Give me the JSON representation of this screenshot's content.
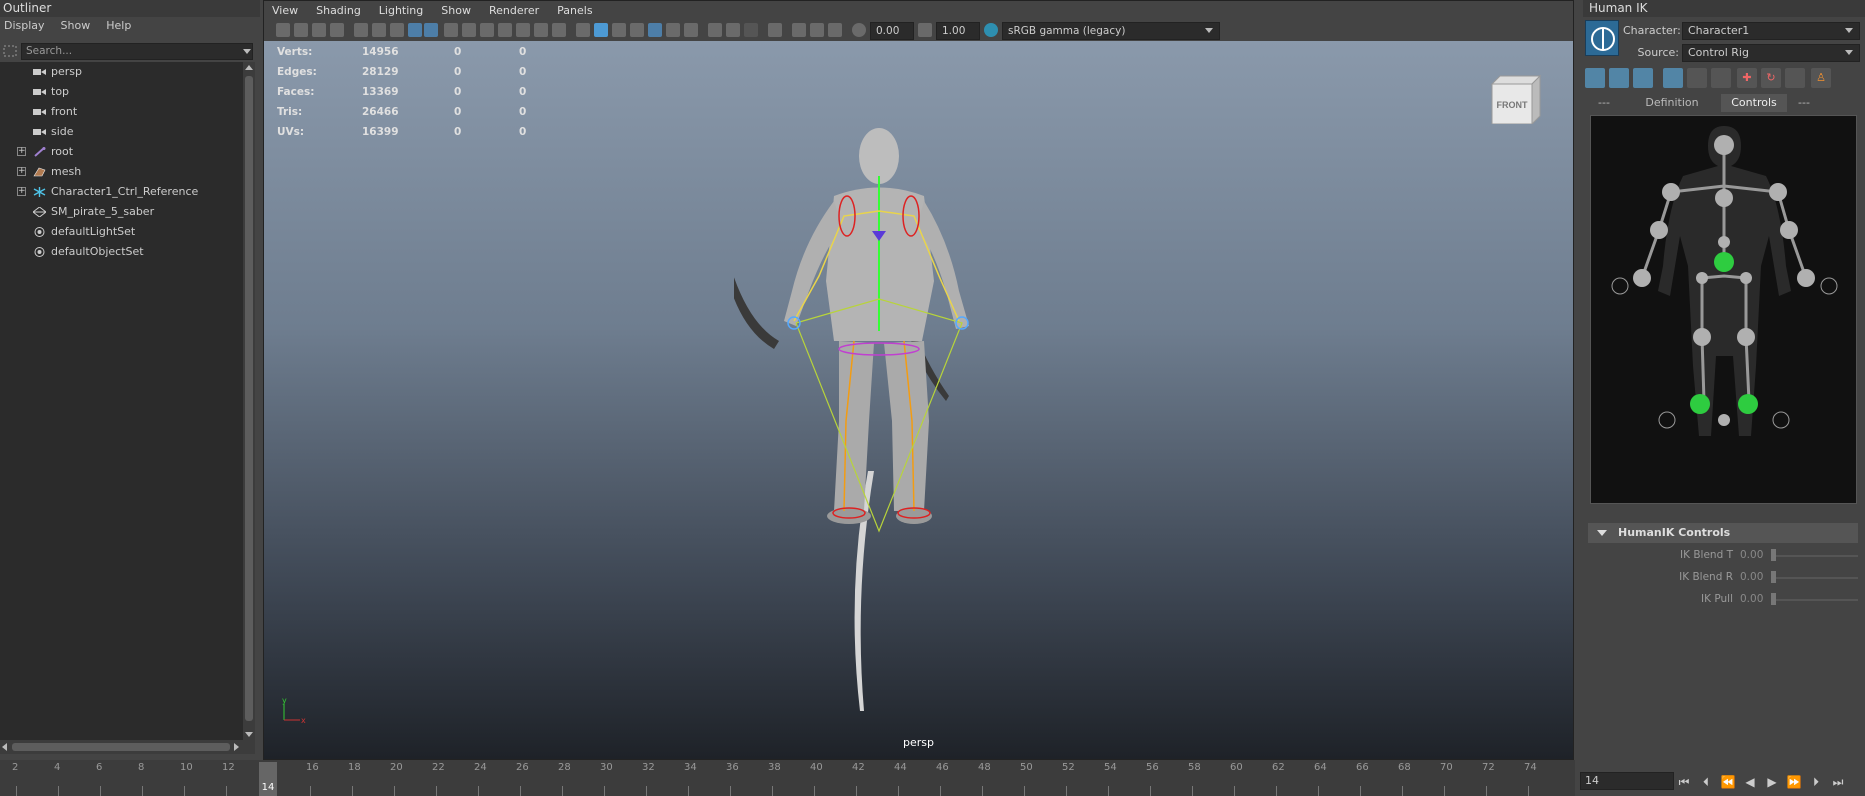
{
  "outliner": {
    "title": "Outliner",
    "menu": [
      "Display",
      "Show",
      "Help"
    ],
    "search_placeholder": "Search...",
    "items": [
      {
        "label": "persp",
        "icon": "camera-icon",
        "expandable": false
      },
      {
        "label": "top",
        "icon": "camera-icon",
        "expandable": false
      },
      {
        "label": "front",
        "icon": "camera-icon",
        "expandable": false
      },
      {
        "label": "side",
        "icon": "camera-icon",
        "expandable": false
      },
      {
        "label": "root",
        "icon": "joint-icon",
        "expandable": true
      },
      {
        "label": "mesh",
        "icon": "mesh-icon",
        "expandable": true
      },
      {
        "label": "Character1_Ctrl_Reference",
        "icon": "hik-reference-icon",
        "expandable": true
      },
      {
        "label": "SM_pirate_5_saber",
        "icon": "transform-icon",
        "expandable": false
      },
      {
        "label": "defaultLightSet",
        "icon": "set-icon",
        "expandable": false
      },
      {
        "label": "defaultObjectSet",
        "icon": "set-icon",
        "expandable": false
      }
    ]
  },
  "viewport": {
    "menu": [
      "View",
      "Shading",
      "Lighting",
      "Show",
      "Renderer",
      "Panels"
    ],
    "exposure_value": "0.00",
    "gamma_value": "1.00",
    "color_space": "sRGB gamma (legacy)",
    "hud": [
      {
        "label": "Verts:",
        "v1": "14956",
        "v2": "0",
        "v3": "0"
      },
      {
        "label": "Edges:",
        "v1": "28129",
        "v2": "0",
        "v3": "0"
      },
      {
        "label": "Faces:",
        "v1": "13369",
        "v2": "0",
        "v3": "0"
      },
      {
        "label": "Tris:",
        "v1": "26466",
        "v2": "0",
        "v3": "0"
      },
      {
        "label": "UVs:",
        "v1": "16399",
        "v2": "0",
        "v3": "0"
      }
    ],
    "viewcube_label": "FRONT",
    "camera_label": "persp",
    "axis_y": "y",
    "axis_x": "x"
  },
  "human_ik": {
    "title": "Human IK",
    "character_label": "Character:",
    "character_value": "Character1",
    "source_label": "Source:",
    "source_value": "Control Rig",
    "tabs": [
      "---",
      "Definition",
      "Controls",
      "---"
    ],
    "active_tab": "Controls",
    "section_title": "HumanIK Controls",
    "sliders": [
      {
        "label": "IK Blend T",
        "value": "0.00"
      },
      {
        "label": "IK Blend R",
        "value": "0.00"
      },
      {
        "label": "IK Pull",
        "value": "0.00"
      }
    ]
  },
  "timeline": {
    "ticks": [
      "2",
      "4",
      "6",
      "8",
      "10",
      "12",
      "14",
      "16",
      "18",
      "20",
      "22",
      "24",
      "26",
      "28",
      "30",
      "32",
      "34",
      "36",
      "38",
      "40",
      "42",
      "44",
      "46",
      "48",
      "50",
      "52",
      "54",
      "56",
      "58",
      "60",
      "62",
      "64",
      "66",
      "68",
      "70",
      "72",
      "74"
    ],
    "current_frame": "14",
    "frame_field": "14"
  },
  "colors": {
    "accent": "#5285a6",
    "active_effector": "#2ecc40",
    "joint_grey": "#b0b0b0"
  }
}
